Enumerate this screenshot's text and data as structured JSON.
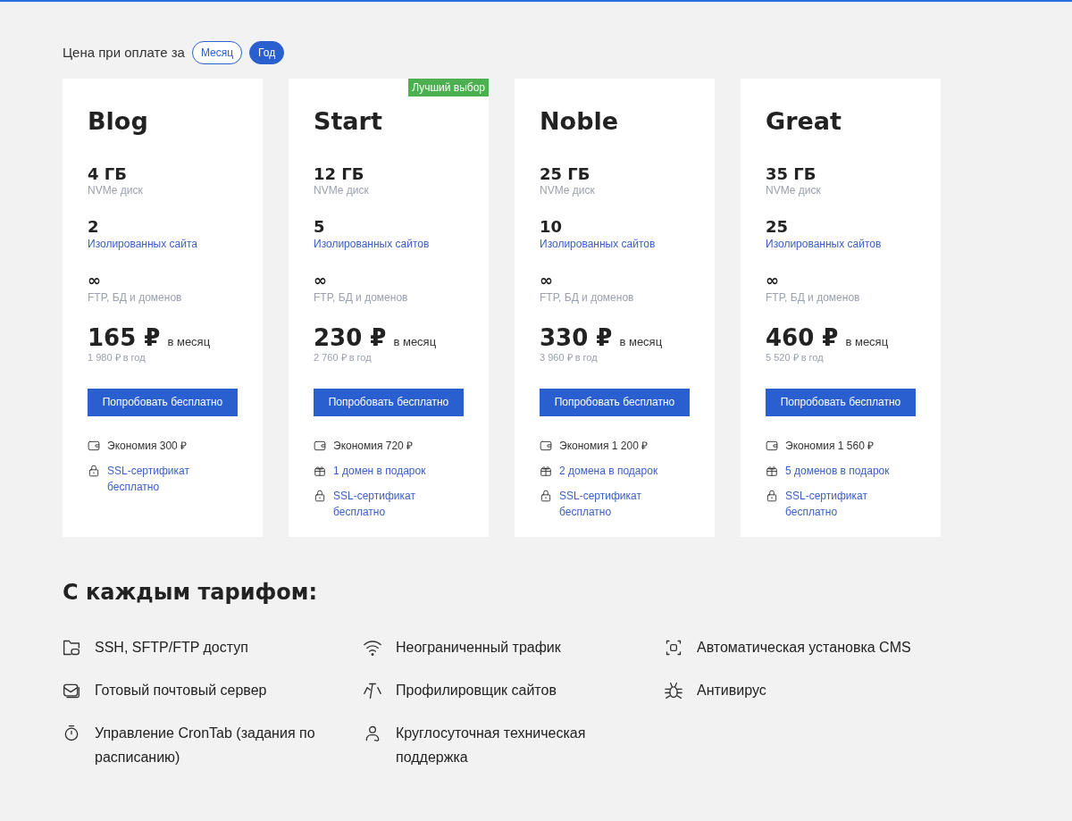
{
  "billing": {
    "label": "Цена при оплате за",
    "options": [
      {
        "label": "Месяц",
        "selected": false
      },
      {
        "label": "Год",
        "selected": true
      }
    ]
  },
  "plans": [
    {
      "name": "Blog",
      "disk": "4 ГБ",
      "disk_label": "NVMe диск",
      "sites": "2",
      "sites_label": "Изолированных сайта",
      "ftp": "∞",
      "ftp_label": "FTP, БД и доменов",
      "price": "165 ₽",
      "price_period": "в месяц",
      "yearly": "1 980 ₽ в год",
      "button": "Попробовать бесплатно",
      "perks": [
        {
          "kind": "savings",
          "text": "Экономия 300 ₽"
        },
        {
          "kind": "ssl",
          "text": "SSL-сертификат бесплатно"
        }
      ]
    },
    {
      "name": "Start",
      "badge": "Лучший выбор",
      "disk": "12 ГБ",
      "disk_label": "NVMe диск",
      "sites": "5",
      "sites_label": "Изолированных сайтов",
      "ftp": "∞",
      "ftp_label": "FTP, БД и доменов",
      "price": "230 ₽",
      "price_period": "в месяц",
      "yearly": "2 760 ₽ в год",
      "button": "Попробовать бесплатно",
      "perks": [
        {
          "kind": "savings",
          "text": "Экономия 720 ₽"
        },
        {
          "kind": "gift",
          "text": "1 домен в подарок"
        },
        {
          "kind": "ssl",
          "text": "SSL-сертификат бесплатно"
        }
      ]
    },
    {
      "name": "Noble",
      "disk": "25 ГБ",
      "disk_label": "NVMe диск",
      "sites": "10",
      "sites_label": "Изолированных сайтов",
      "ftp": "∞",
      "ftp_label": "FTP, БД и доменов",
      "price": "330 ₽",
      "price_period": "в месяц",
      "yearly": "3 960 ₽ в год",
      "button": "Попробовать бесплатно",
      "perks": [
        {
          "kind": "savings",
          "text": "Экономия 1 200 ₽"
        },
        {
          "kind": "gift",
          "text": "2 домена в подарок"
        },
        {
          "kind": "ssl",
          "text": "SSL-сертификат бесплатно"
        }
      ]
    },
    {
      "name": "Great",
      "disk": "35 ГБ",
      "disk_label": "NVMe диск",
      "sites": "25",
      "sites_label": "Изолированных сайтов",
      "ftp": "∞",
      "ftp_label": "FTP, БД и доменов",
      "price": "460 ₽",
      "price_period": "в месяц",
      "yearly": "5 520 ₽ в год",
      "button": "Попробовать бесплатно",
      "perks": [
        {
          "kind": "savings",
          "text": "Экономия 1 560 ₽"
        },
        {
          "kind": "gift",
          "text": "5 доменов в подарок"
        },
        {
          "kind": "ssl",
          "text": "SSL-сертификат бесплатно"
        }
      ]
    }
  ],
  "features": {
    "title": "С каждым тарифом:",
    "columns": [
      [
        {
          "kind": "folder",
          "text": "SSH, SFTP/FTP доступ"
        },
        {
          "kind": "mail",
          "text": "Готовый почтовый сервер"
        },
        {
          "kind": "timer",
          "text": "Управление CronTab (задания по расписанию)"
        }
      ],
      [
        {
          "kind": "wifi",
          "text": "Неограниченный трафик"
        },
        {
          "kind": "gauge",
          "text": "Профилировщик сайтов"
        },
        {
          "kind": "support",
          "text": "Круглосуточная техническая поддержка"
        }
      ],
      [
        {
          "kind": "install",
          "text": "Автоматическая установка CMS"
        },
        {
          "kind": "bug",
          "text": "Антивирус"
        }
      ]
    ]
  }
}
